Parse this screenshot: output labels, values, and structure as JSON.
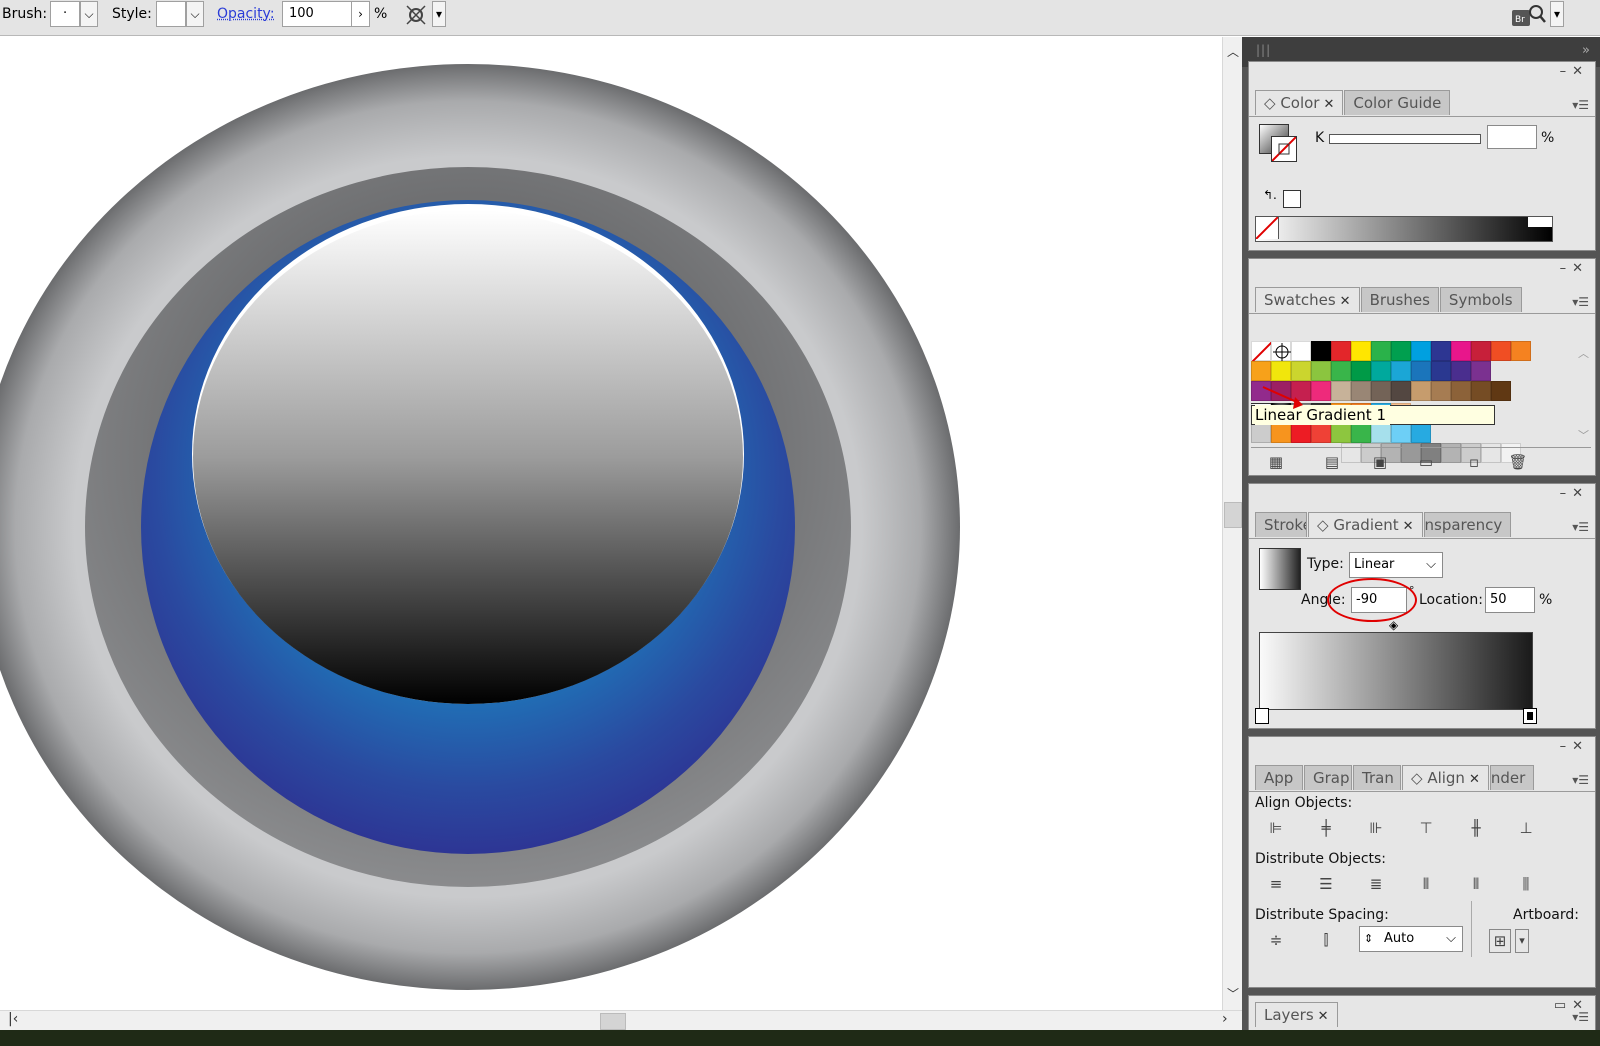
{
  "toolbar": {
    "brush_label": "Brush:",
    "brush_value": "·",
    "style_label": "Style:",
    "opacity_label": "Opacity:",
    "opacity_value": "100",
    "opacity_unit": "%"
  },
  "color_panel": {
    "tabs": [
      "Color",
      "Color Guide"
    ],
    "k_label": "K",
    "k_value": "",
    "k_unit": "%"
  },
  "swatches_panel": {
    "tabs": [
      "Swatches",
      "Brushes",
      "Symbols"
    ],
    "tooltip": "Linear Gradient 1",
    "row1": [
      "#ffffff",
      "#000000",
      "#e3262a",
      "#ffe600",
      "#2ab24a",
      "#009f4f",
      "#00a0e0",
      "#2d3692",
      "#e8168b",
      "#c7203a",
      "#f04e23",
      "#f58220"
    ],
    "row2": [
      "#f7a11a",
      "#f1e60c",
      "#cbd52e",
      "#8bc53f",
      "#39b54a",
      "#009a47",
      "#00a99d",
      "#1ba6d6",
      "#1b75bb",
      "#2a3890",
      "#4a2e8e",
      "#7b3190"
    ],
    "row3": [
      "#922a8c",
      "#9c1f63",
      "#c5204f",
      "#ee2a7b",
      "#c7b299",
      "#998675",
      "#736357",
      "#534741",
      "#c69c6d",
      "#a67c52",
      "#8c6239",
      "#754c24",
      "#603813"
    ],
    "row4": [
      "#808080",
      "#333333",
      "#f7941e",
      "#ee7d23",
      "#29abe2",
      "#f9c190"
    ],
    "row5": [
      "#cccccc",
      "#f7941e",
      "#ed1c24",
      "#ef4136",
      "#8dc63f",
      "#39b54a",
      "#a6e0ec",
      "#6dcff6",
      "#27aae1"
    ],
    "row6": [
      "#e6e6e6",
      "#cccccc",
      "#b3b3b3",
      "#999999",
      "#808080",
      "#b3b3b3",
      "#cccccc",
      "#e6e6e6",
      "#f2f2f2"
    ]
  },
  "gradient_panel": {
    "tabs": [
      "Stroke",
      "Gradient",
      "nsparency"
    ],
    "type_label": "Type:",
    "type_value": "Linear",
    "angle_label": "Angle:",
    "angle_value": "-90",
    "angle_unit": "°",
    "location_label": "Location:",
    "location_value": "50",
    "location_unit": "%"
  },
  "align_panel": {
    "tabs": [
      "App",
      "Grap",
      "Tran",
      "Align",
      "nder"
    ],
    "align_objects_label": "Align Objects:",
    "distribute_objects_label": "Distribute Objects:",
    "distribute_spacing_label": "Distribute Spacing:",
    "artboard_label": "Artboard:",
    "spacing_value": "Auto"
  },
  "layers_panel": {
    "tab": "Layers"
  },
  "colors": {
    "accent_blue": "#2a3cd8",
    "highlight_red": "#e00000",
    "tooltip_bg": "#ffffe1"
  }
}
